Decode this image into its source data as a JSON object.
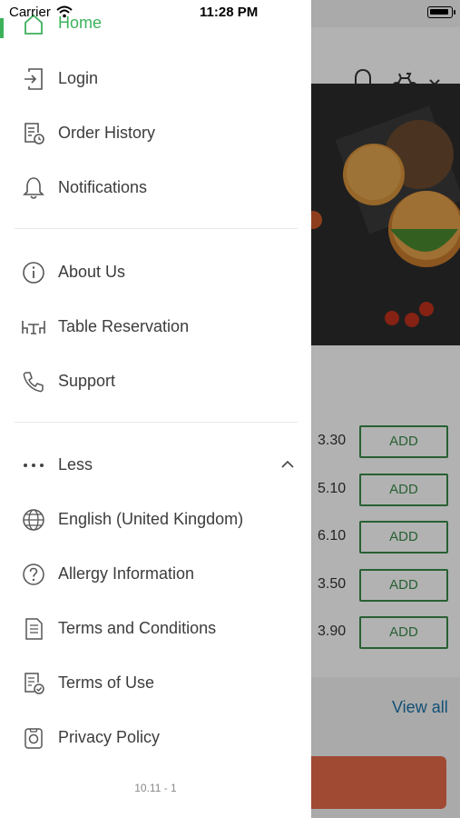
{
  "status_bar": {
    "carrier": "Carrier",
    "time": "11:28 PM"
  },
  "drawer": {
    "home_label": "Home",
    "section1": [
      {
        "label": "Login",
        "icon": "login-icon"
      },
      {
        "label": "Order History",
        "icon": "order-history-icon"
      },
      {
        "label": "Notifications",
        "icon": "bell-icon"
      }
    ],
    "section2": [
      {
        "label": "About Us",
        "icon": "info-icon"
      },
      {
        "label": "Table Reservation",
        "icon": "table-icon"
      },
      {
        "label": "Support",
        "icon": "phone-icon"
      }
    ],
    "less_label": "Less",
    "section3": [
      {
        "label": "English (United Kingdom)",
        "icon": "globe-icon"
      },
      {
        "label": "Allergy Information",
        "icon": "question-icon"
      },
      {
        "label": "Terms and Conditions",
        "icon": "document-icon"
      },
      {
        "label": "Terms of Use",
        "icon": "document-check-icon"
      },
      {
        "label": "Privacy Policy",
        "icon": "privacy-icon"
      }
    ],
    "version": "10.11 - 1",
    "accent_color": "#3cb15a"
  },
  "background": {
    "items": [
      {
        "price": "3.30",
        "button": "ADD"
      },
      {
        "price": "5.10",
        "button": "ADD"
      },
      {
        "price": "6.10",
        "button": "ADD"
      },
      {
        "price": "3.50",
        "button": "ADD"
      },
      {
        "price": "3.90",
        "button": "ADD"
      }
    ],
    "view_all": "View all",
    "button_color": "#3a8a4a",
    "link_color": "#1a73a8"
  }
}
